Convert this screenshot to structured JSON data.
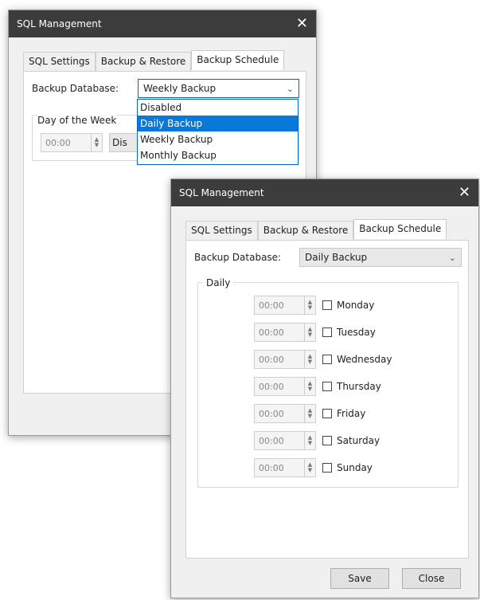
{
  "back_window": {
    "title": "SQL Management",
    "tabs": [
      "SQL Settings",
      "Backup & Restore",
      "Backup Schedule"
    ],
    "backup_label": "Backup Database:",
    "backup_value": "Weekly Backup",
    "group_label": "Day of the Week",
    "time_value": "00:00",
    "partial_select": "Dis",
    "dropdown_options": [
      "Disabled",
      "Daily Backup",
      "Weekly Backup",
      "Monthly Backup"
    ],
    "highlighted_option": "Daily Backup"
  },
  "front_window": {
    "title": "SQL Management",
    "tabs": [
      "SQL Settings",
      "Backup & Restore",
      "Backup Schedule"
    ],
    "backup_label": "Backup Database:",
    "backup_value": "Daily Backup",
    "group_label": "Daily",
    "days": [
      {
        "time": "00:00",
        "label": "Monday",
        "checked": false
      },
      {
        "time": "00:00",
        "label": "Tuesday",
        "checked": false
      },
      {
        "time": "00:00",
        "label": "Wednesday",
        "checked": false
      },
      {
        "time": "00:00",
        "label": "Thursday",
        "checked": false
      },
      {
        "time": "00:00",
        "label": "Friday",
        "checked": false
      },
      {
        "time": "00:00",
        "label": "Saturday",
        "checked": false
      },
      {
        "time": "00:00",
        "label": "Sunday",
        "checked": false
      }
    ],
    "save_label": "Save",
    "close_label": "Close"
  },
  "icons": {
    "close_glyph": "✕",
    "chevron_glyph": "⌄",
    "spin_up": "▲",
    "spin_down": "▼"
  },
  "colors": {
    "titlebar": "#3c3c3c",
    "selection": "#0a78d7",
    "focus_border": "#0a64c8"
  }
}
